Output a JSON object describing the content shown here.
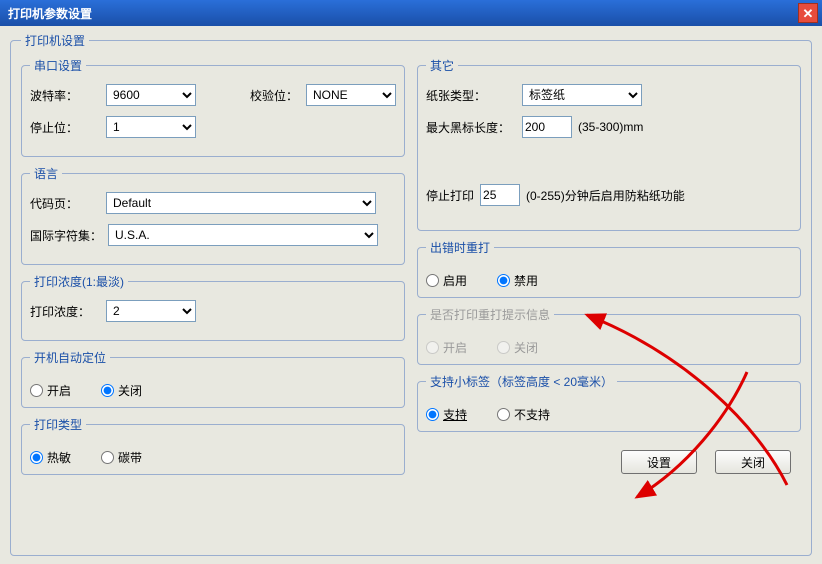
{
  "window": {
    "title": "打印机参数设置"
  },
  "mainGroup": "打印机设置",
  "serial": {
    "legend": "串口设置",
    "baud_label": "波特率：",
    "baud_value": "9600",
    "parity_label": "校验位：",
    "parity_value": "NONE",
    "stop_label": "停止位：",
    "stop_value": "1"
  },
  "language": {
    "legend": "语言",
    "codepage_label": "代码页：",
    "codepage_value": "Default",
    "charset_label": "国际字符集：",
    "charset_value": "U.S.A."
  },
  "density": {
    "legend": "打印浓度(1:最淡)",
    "label": "打印浓度：",
    "value": "2"
  },
  "autopos": {
    "legend": "开机自动定位",
    "opt_on": "开启",
    "opt_off": "关闭"
  },
  "printtype": {
    "legend": "打印类型",
    "opt_thermal": "热敏",
    "opt_ribbon": "碳带"
  },
  "other": {
    "legend": "其它",
    "papertype_label": "纸张类型：",
    "papertype_value": "标签纸",
    "maxblack_label": "最大黑标长度：",
    "maxblack_value": "200",
    "maxblack_hint": "(35-300)mm",
    "stopprint_label": "停止打印",
    "stopprint_value": "25",
    "stopprint_hint": "(0-255)分钟后启用防粘纸功能"
  },
  "reprint": {
    "legend": "出错时重打",
    "opt_enable": "启用",
    "opt_disable": "禁用"
  },
  "suggest": {
    "legend": "是否打印重打提示信息",
    "opt_on": "开启",
    "opt_off": "关闭"
  },
  "smalllabel": {
    "legend": "支持小标签（标签高度 < 20毫米）",
    "opt_support": "支持",
    "opt_nosupport": "不支持"
  },
  "buttons": {
    "set": "设置",
    "close": "关闭"
  }
}
